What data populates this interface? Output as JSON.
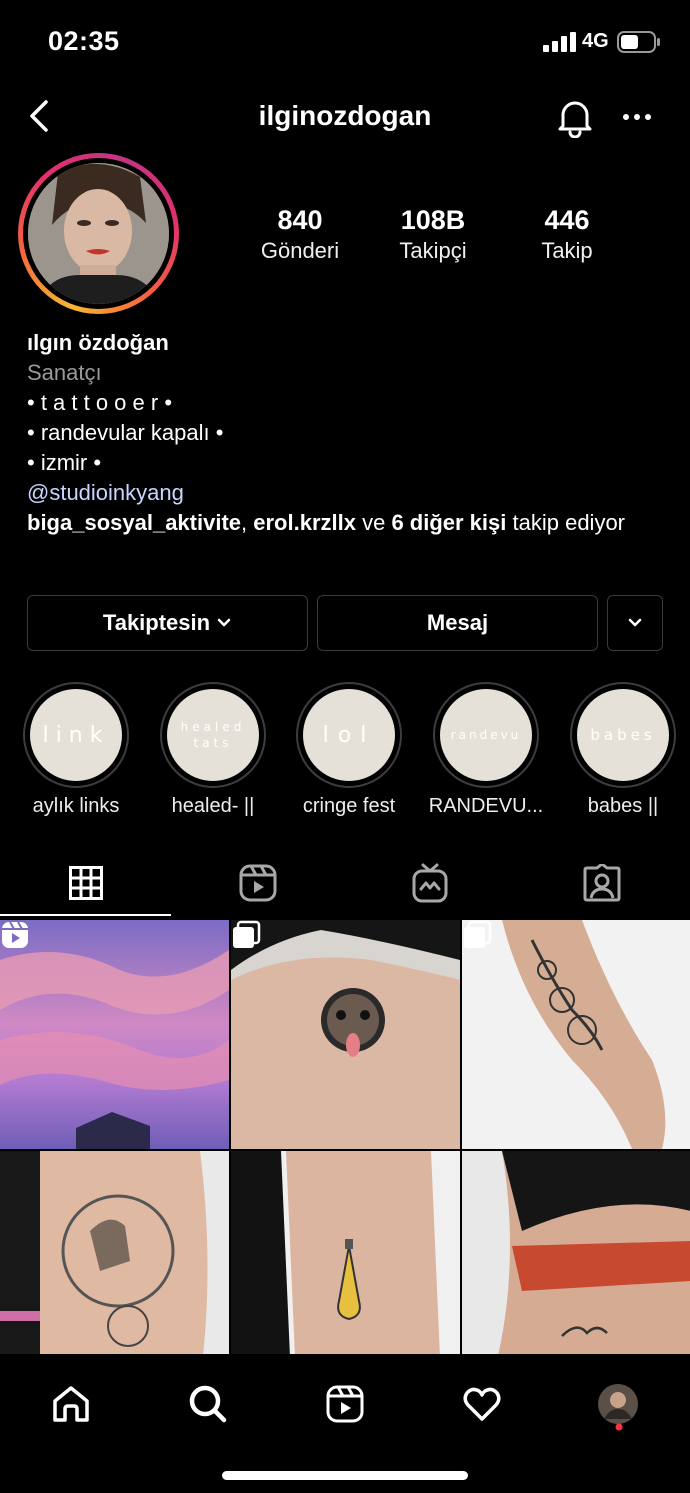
{
  "status_bar": {
    "time": "02:35",
    "network": "4G"
  },
  "header": {
    "username": "ilginozdogan"
  },
  "stats": [
    {
      "value": "840",
      "label": "Gönderi"
    },
    {
      "value": "108B",
      "label": "Takipçi"
    },
    {
      "value": "446",
      "label": "Takip"
    }
  ],
  "bio": {
    "name": "ılgın özdoğan",
    "category": "Sanatçı",
    "lines": [
      "• t a t t o o e r •",
      "• randevular kapalı •",
      "• izmir •"
    ],
    "link": "@studioinkyang",
    "followed_by": {
      "user1": "biga_sosyal_aktivite",
      "sep": ", ",
      "user2": "erol.krzllx",
      "and": " ve ",
      "others": "6 diğer kişi",
      "suffix": " takip ediyor"
    }
  },
  "actions": {
    "following": "Takiptesin",
    "message": "Mesaj"
  },
  "highlights": [
    {
      "cover": "link",
      "caption": "aylık links"
    },
    {
      "cover": "healed\ntats",
      "caption": "healed- ||"
    },
    {
      "cover": "lol",
      "caption": "cringe fest"
    },
    {
      "cover": "randevu",
      "caption": "RANDEVU..."
    },
    {
      "cover": "babes",
      "caption": "babes ||"
    }
  ],
  "icons": {
    "back": "chevron-left-icon",
    "bell": "bell-icon",
    "more": "more-horizontal-icon",
    "grid": "grid-icon",
    "reels": "reels-icon",
    "igtv": "igtv-icon",
    "tagged": "tagged-icon",
    "home": "home-icon",
    "search": "search-icon",
    "heart": "heart-icon"
  },
  "colors": {
    "background": "#000000",
    "text": "#ffffff",
    "muted": "#9a9a9a",
    "link": "#c9d6ff",
    "highlight_bg": "#e5e1d8",
    "notification_dot": "#ff3040"
  }
}
